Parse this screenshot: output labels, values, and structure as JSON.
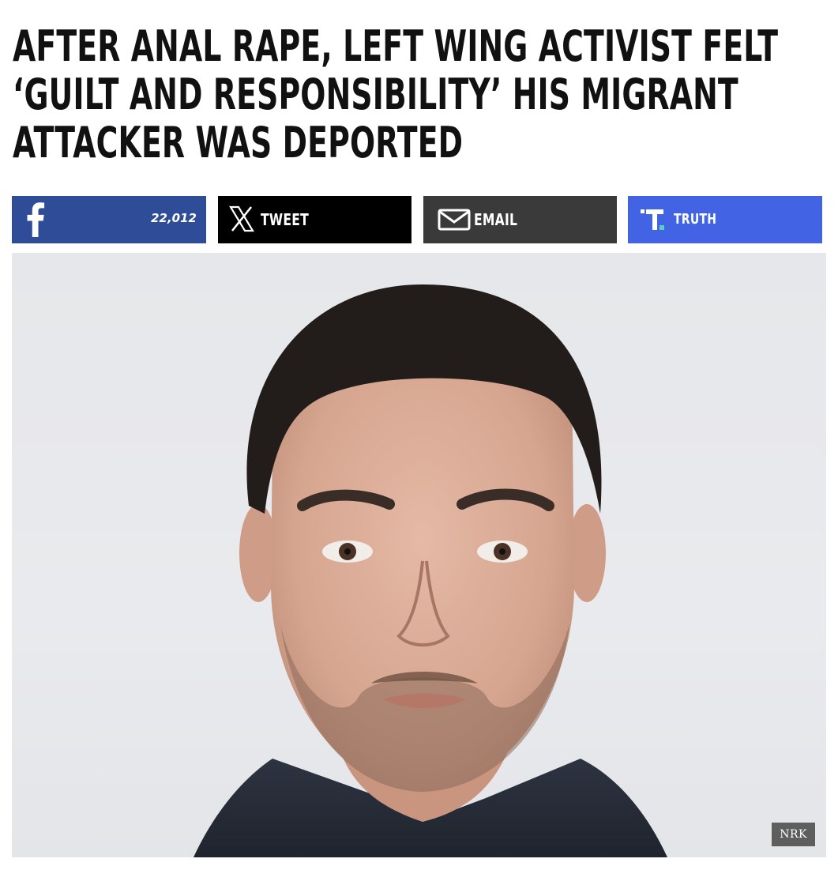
{
  "headline": {
    "lines": [
      "AFTER ANAL RAPE, LEFT WING ACTIVIST FELT",
      "‘GUILT AND RESPONSIBILITY’ HIS MIGRANT",
      "ATTACKER WAS DEPORTED"
    ]
  },
  "share_bar": {
    "facebook": {
      "icon": "facebook-icon",
      "count": "22,012",
      "color": "#2e4c98"
    },
    "x": {
      "icon": "x-logo-icon",
      "label": "TWEET",
      "color": "#000000"
    },
    "email": {
      "icon": "envelope-icon",
      "label": "EMAIL",
      "color": "#3a3a3a"
    },
    "truth": {
      "icon": "truth-social-icon",
      "label": "TRUTH",
      "color": "#4263e3"
    }
  },
  "photo": {
    "credit": "NRK"
  }
}
